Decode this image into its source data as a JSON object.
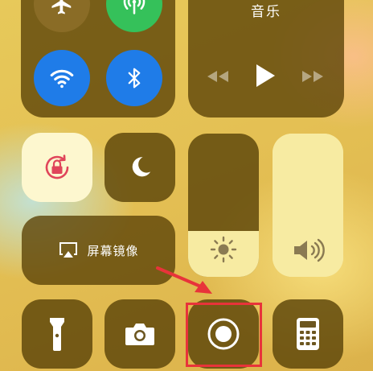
{
  "control_center": {
    "connectivity": {
      "items": [
        {
          "name": "airplane-mode",
          "icon": "airplane-icon",
          "active": false
        },
        {
          "name": "cellular-data",
          "icon": "antenna-icon",
          "active": true
        },
        {
          "name": "wifi",
          "icon": "wifi-icon",
          "active": true
        },
        {
          "name": "bluetooth",
          "icon": "bluetooth-icon",
          "active": true
        }
      ]
    },
    "music": {
      "title": "音乐",
      "controls": [
        "rewind-icon",
        "play-icon",
        "fast-forward-icon"
      ]
    },
    "orientation_lock": {
      "icon": "rotation-lock-icon",
      "active": true
    },
    "do_not_disturb": {
      "icon": "moon-icon",
      "active": false
    },
    "screen_mirroring": {
      "label": "屏幕镜像",
      "icon": "airplay-icon"
    },
    "brightness": {
      "icon": "sun-icon",
      "level": 0.32
    },
    "volume": {
      "icon": "speaker-icon",
      "level": 1.0
    },
    "bottom_tiles": [
      {
        "name": "flashlight",
        "icon": "flashlight-icon"
      },
      {
        "name": "camera",
        "icon": "camera-icon"
      },
      {
        "name": "screen-recording",
        "icon": "record-icon",
        "highlighted": true
      },
      {
        "name": "calculator",
        "icon": "calculator-icon"
      }
    ],
    "colors": {
      "module_bg": "#5c4408",
      "active_blue": "#1f7ce8",
      "active_green": "#35c15a",
      "highlight_red": "#e8333a",
      "lock_red": "#e0455a"
    }
  }
}
